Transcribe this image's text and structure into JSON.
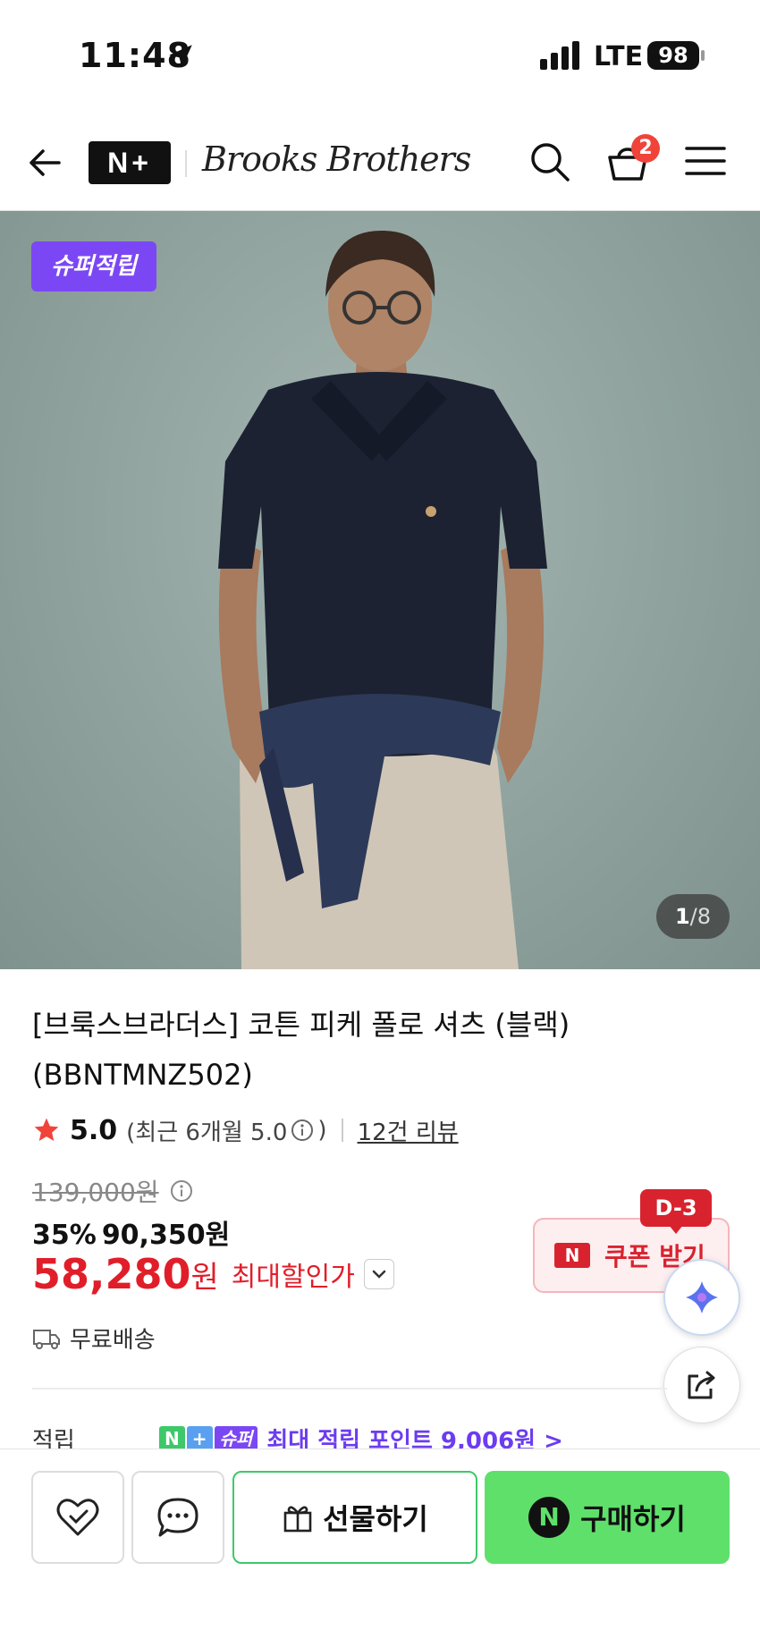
{
  "status_bar": {
    "time": "11:48",
    "network": "LTE",
    "battery": "98"
  },
  "header": {
    "store_logo": "N+",
    "brand_logo": "Brooks Brothers",
    "cart_count": "2"
  },
  "hero": {
    "badge": "슈퍼적립",
    "counter_current": "1",
    "counter_total": "/8"
  },
  "product": {
    "title": "[브룩스브라더스] 코튼 피케 폴로 셔츠 (블랙) (BBNTMNZ502)",
    "rating": "5.0",
    "rating_recent": "(최근 6개월 5.0",
    "rating_close": ")",
    "review_link": "12건 리뷰",
    "original_price": "139,000원",
    "discount_rate": "35%",
    "discount_price": "90,350원",
    "final_price": "58,280",
    "final_won": "원",
    "final_label": "최대할인가",
    "shipping": "무료배송"
  },
  "coupon": {
    "dday": "D-3",
    "n_mark": "N",
    "label": "쿠폰 받기"
  },
  "points": {
    "label": "적립",
    "badge_n": "N",
    "badge_plus": "+",
    "badge_super": "슈퍼",
    "text": "최대 적립 포인트 9,006원 >"
  },
  "bottom_bar": {
    "gift_label": "선물하기",
    "buy_n": "N",
    "buy_label": "구매하기"
  },
  "colors": {
    "accent_green": "#5fe06b",
    "accent_red": "#d8232e",
    "accent_purple": "#7b47f5"
  }
}
